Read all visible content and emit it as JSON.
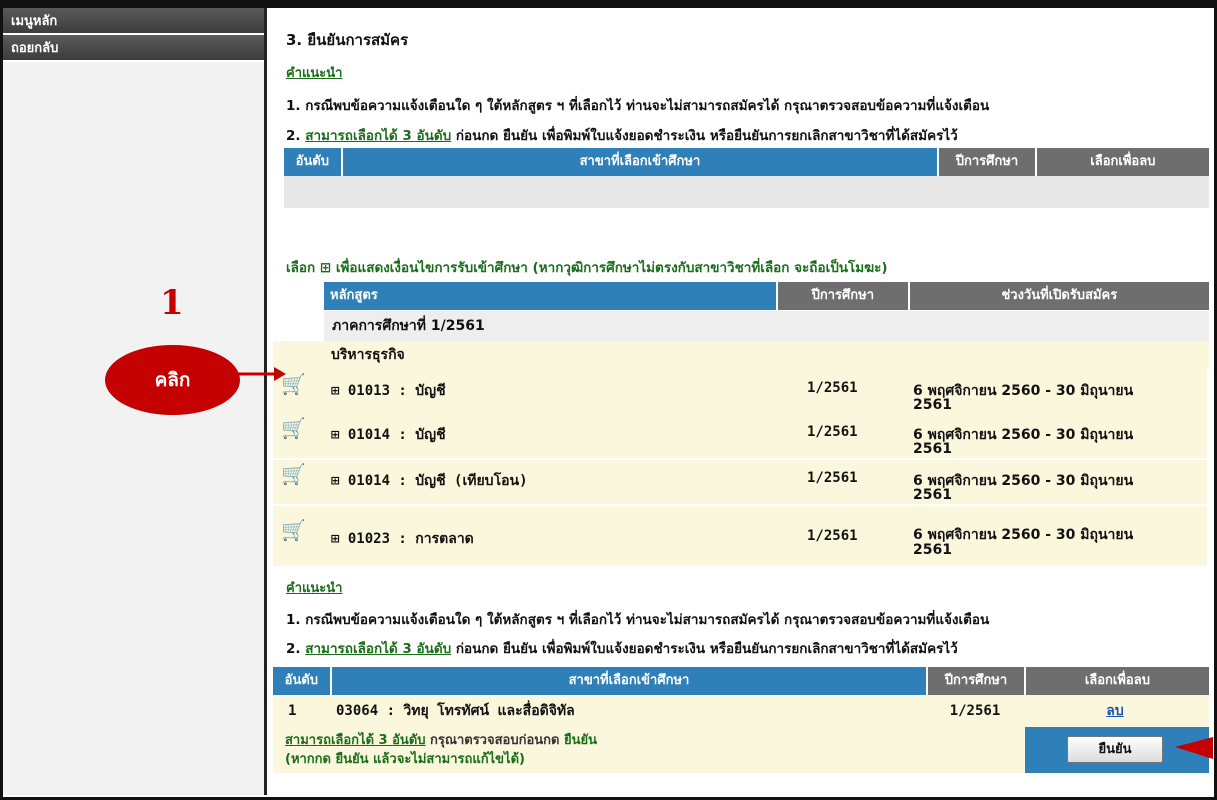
{
  "sidebar": {
    "items": [
      {
        "label": "เมนูหลัก"
      },
      {
        "label": "ถอยกลับ"
      }
    ]
  },
  "page_title": "3. ยืนยันการสมัคร",
  "advice_label": "คำแนะนำ",
  "notes": {
    "note1": "1. กรณีพบข้อความแจ้งเตือนใด ๆ ใต้หลักสูตร ฯ ที่เลือกไว้ ท่านจะไม่สามารถสมัครได้ กรุณาตรวจสอบข้อความที่แจ้งเตือน",
    "note2_prefix": "2. ",
    "note2_link": "สามารถเลือกได้ 3 อันดับ",
    "note2_rest": " ก่อนกด ยืนยัน  เพื่อพิมพ์ใบแจ้งยอดชำระเงิน หรือยืนยันการยกเลิกสาขาวิชาที่ได้สมัครไว้"
  },
  "selected_table": {
    "headers": {
      "rank": "อันดับ",
      "major": "สาขาที่เลือกเข้าศึกษา",
      "year": "ปีการศึกษา",
      "delete": "เลือกเพื่อลบ"
    }
  },
  "select_hint": {
    "prefix": "เลือก",
    "icon": "⊞",
    "text": "เพื่อแสดงเงื่อนไขการรับเข้าศึกษา (หากวุฒิการศึกษาไม่ตรงกับสาขาวิชาที่เลือก จะถือเป็นโมฆะ)"
  },
  "course_table": {
    "headers": {
      "course": "หลักสูตร",
      "year": "ปีการศึกษา",
      "period": "ช่วงวันที่เปิดรับสมัคร"
    },
    "semester": "ภาคการศึกษาที่ 1/2561",
    "group": "บริหารธุรกิจ",
    "rows": [
      {
        "code": "⊞ 01013 : บัญชี",
        "year": "1/2561",
        "period_line1": "6 พฤศจิกายน 2560 - 30 มิถุนายน",
        "period_line2": "2561"
      },
      {
        "code": "⊞ 01014 : บัญชี",
        "year": "1/2561",
        "period_line1": "6 พฤศจิกายน 2560 - 30 มิถุนายน",
        "period_line2": "2561"
      },
      {
        "code": "⊞ 01014 : บัญชี (เทียบโอน)",
        "year": "1/2561",
        "period_line1": "6 พฤศจิกายน 2560 - 30 มิถุนายน",
        "period_line2": "2561"
      },
      {
        "code": "⊞ 01023 : การตลาด",
        "year": "1/2561",
        "period_line1": "6 พฤศจิกายน 2560 - 30 มิถุนายน",
        "period_line2": "2561"
      }
    ]
  },
  "annotation": {
    "number": "1",
    "bubble": "คลิก"
  },
  "selected_rows": [
    {
      "rank": "1",
      "major": "03064 : วิทยุ โทรทัศน์ และสื่อดิจิทัล",
      "year": "1/2561",
      "delete": "ลบ"
    }
  ],
  "footer": {
    "link": "สามารถเลือกได้ 3 อันดับ",
    "text1": " กรุณาตรวจสอบก่อนกด ",
    "confirm_word": "ยืนยัน",
    "text2": "(หากกด ยืนยัน แล้วจะไม่สามารถแก้ไขได้)"
  },
  "confirm_button": "ยืนยัน",
  "colors": {
    "header_blue": "#2f7fb8",
    "header_grey": "#6e6e6e",
    "row_yellow": "#fbf7dc",
    "annotation_red": "#c40000",
    "link_green": "#1a6e1a"
  }
}
